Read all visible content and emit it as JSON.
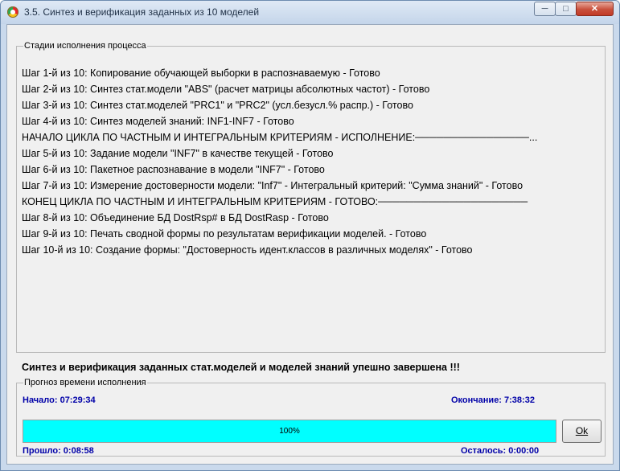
{
  "window": {
    "title": "3.5. Синтез и верификация заданных из 10 моделей",
    "controls": {
      "minimize": "─",
      "maximize": "□",
      "close": "✕"
    }
  },
  "stages": {
    "legend": "Стадии исполнения процесса",
    "items": [
      "Шаг 1-й из 10: Копирование обучающей выборки в распознаваемую - Готово",
      "Шаг 2-й из 10: Синтез стат.модели \"ABS\" (расчет матрицы абсолютных частот) - Готово",
      "Шаг 3-й из 10: Синтез стат.моделей \"PRC1\" и \"PRC2\" (усл.безусл.% распр.) - Готово",
      "Шаг 4-й из 10: Синтез моделей знаний: INF1-INF7 - Готово",
      "НАЧАЛО ЦИКЛА ПО ЧАСТНЫМ И ИНТЕГРАЛЬНЫМ КРИТЕРИЯМ - ИСПОЛНЕНИЕ:────────────────...",
      "Шаг 5-й из 10: Задание модели \"INF7\" в качестве текущей - Готово",
      "Шаг 6-й из 10: Пакетное распознавание в модели \"INF7\" - Готово",
      "Шаг 7-й из 10: Измерение достоверности модели: \"Inf7\" - Интегральный критерий: \"Сумма знаний\" - Готово",
      "КОНЕЦ ЦИКЛА ПО ЧАСТНЫМ И ИНТЕГРАЛЬНЫМ КРИТЕРИЯМ - ГОТОВО:─────────────────────",
      "Шаг 8-й из 10: Объединение БД DostRsp# в БД DostRasp - Готово",
      "Шаг 9-й из 10: Печать сводной формы по результатам верификации моделей. - Готово",
      "Шаг 10-й из 10: Создание формы: \"Достоверность идент.классов в различных моделях\" - Готово"
    ]
  },
  "status_message": "Синтез и верификация заданных стат.моделей и моделей знаний упешно завершена !!!",
  "forecast": {
    "legend": "Прогноз времени исполнения",
    "start": "Начало:  07:29:34",
    "end": "Окончание:  7:38:32",
    "elapsed": "Прошло:  0:08:58",
    "remaining": "Осталось:  0:00:00",
    "progress_percent": 100,
    "progress_label": "100%",
    "progress_color": "#00ffff",
    "ok_label": "Ok"
  }
}
